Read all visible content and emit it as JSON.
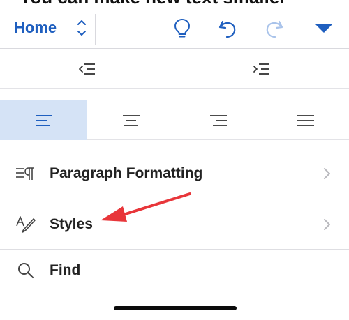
{
  "partial_top_text": "You can make new text smaller",
  "toolbar": {
    "tab_label": "Home",
    "icons": {
      "stepper": "up-down-chevron-icon",
      "ideas": "lightbulb-icon",
      "undo": "undo-icon",
      "redo": "redo-icon",
      "collapse": "triangle-down-icon"
    },
    "colors": {
      "accent": "#1f5fbf",
      "disabled": "#a9c3ea"
    }
  },
  "indent": {
    "decrease_icon": "decrease-indent-icon",
    "increase_icon": "increase-indent-icon"
  },
  "alignment": {
    "options": [
      "align-left",
      "align-center",
      "align-right",
      "justify"
    ],
    "selected": "align-left",
    "selected_color": "#d5e3f6"
  },
  "menu": {
    "items": [
      {
        "label": "Paragraph Formatting",
        "icon": "paragraph-formatting-icon",
        "has_chevron": true
      },
      {
        "label": "Styles",
        "icon": "styles-icon",
        "has_chevron": true
      },
      {
        "label": "Find",
        "icon": "search-icon",
        "has_chevron": false
      }
    ]
  },
  "annotation": {
    "type": "red-arrow",
    "color": "#e8363a",
    "points_to": "Styles"
  }
}
